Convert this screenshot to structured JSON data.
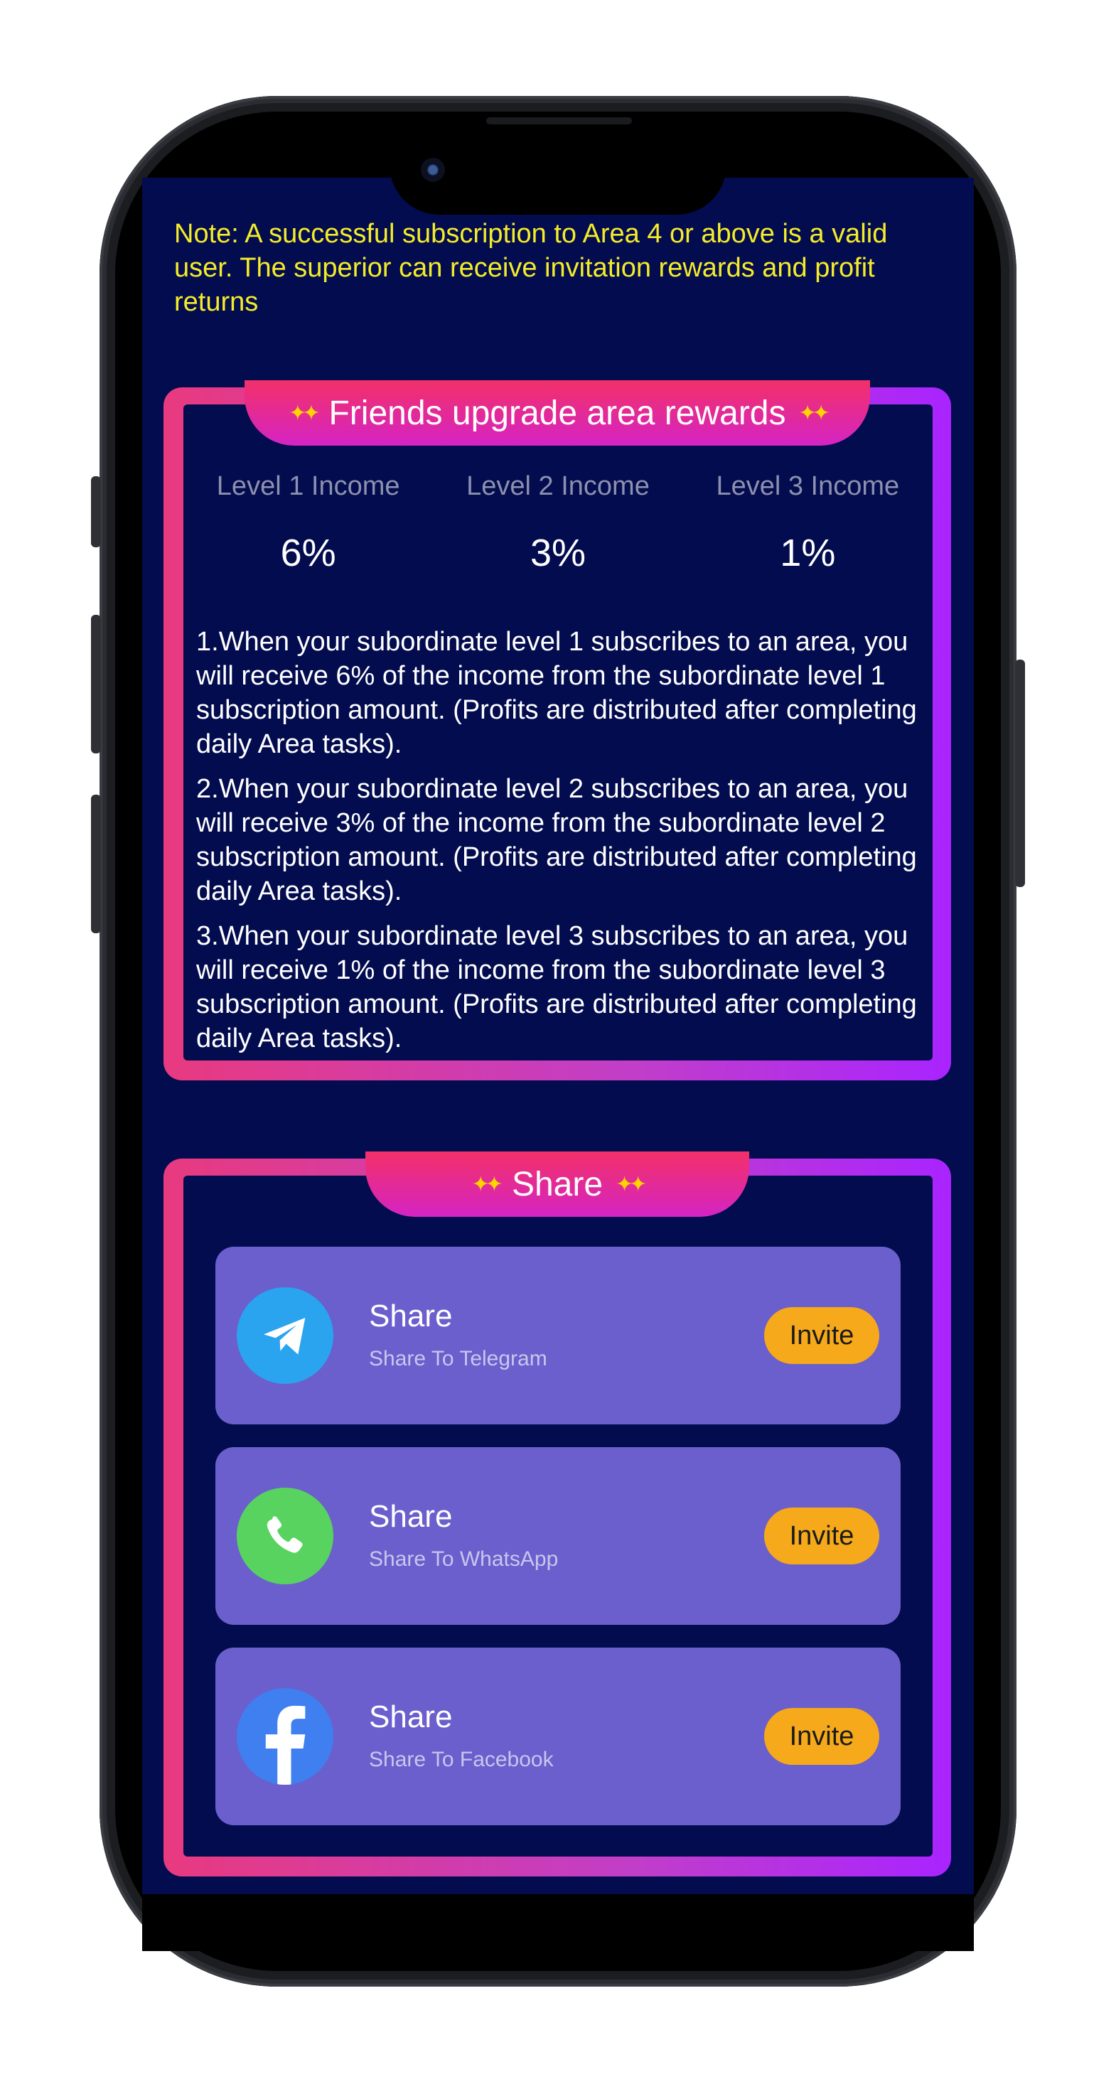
{
  "note": "Note: A successful subscription to Area 4 or above is a valid user. The superior can receive invitation rewards and profit returns",
  "rewards": {
    "title": "Friends upgrade area rewards",
    "levels": [
      {
        "label": "Level 1 Income",
        "value": "6%"
      },
      {
        "label": "Level 2 Income",
        "value": "3%"
      },
      {
        "label": "Level 3 Income",
        "value": "1%"
      }
    ],
    "rules": [
      "1.When your subordinate level 1 subscribes to an area, you will receive 6% of the income from the subordinate level 1 subscription amount. (Profits are distributed after completing daily Area tasks).",
      "2.When your subordinate level 2 subscribes to an area, you will receive 3% of the income from the subordinate level 2 subscription amount. (Profits are distributed after completing daily Area tasks).",
      "3.When your subordinate level 3 subscribes to an area, you will receive 1% of the income from the subordinate level 3 subscription amount. (Profits are distributed after completing daily Area tasks)."
    ]
  },
  "share": {
    "title": "Share",
    "items": [
      {
        "title": "Share",
        "subtitle": "Share To Telegram",
        "button": "Invite",
        "icon": "telegram-icon",
        "color": "#2aa4ee"
      },
      {
        "title": "Share",
        "subtitle": "Share To WhatsApp",
        "button": "Invite",
        "icon": "whatsapp-icon",
        "color": "#58d35f"
      },
      {
        "title": "Share",
        "subtitle": "Share To Facebook",
        "button": "Invite",
        "icon": "facebook-icon",
        "color": "#3f7ff0"
      }
    ]
  },
  "colors": {
    "background": "#030c4e",
    "note_text": "#f4ec2a",
    "card_gradient_start": "#e83a7f",
    "card_gradient_end": "#a924ff",
    "share_item": "#6a5fcc",
    "invite_button": "#f6a91a"
  }
}
